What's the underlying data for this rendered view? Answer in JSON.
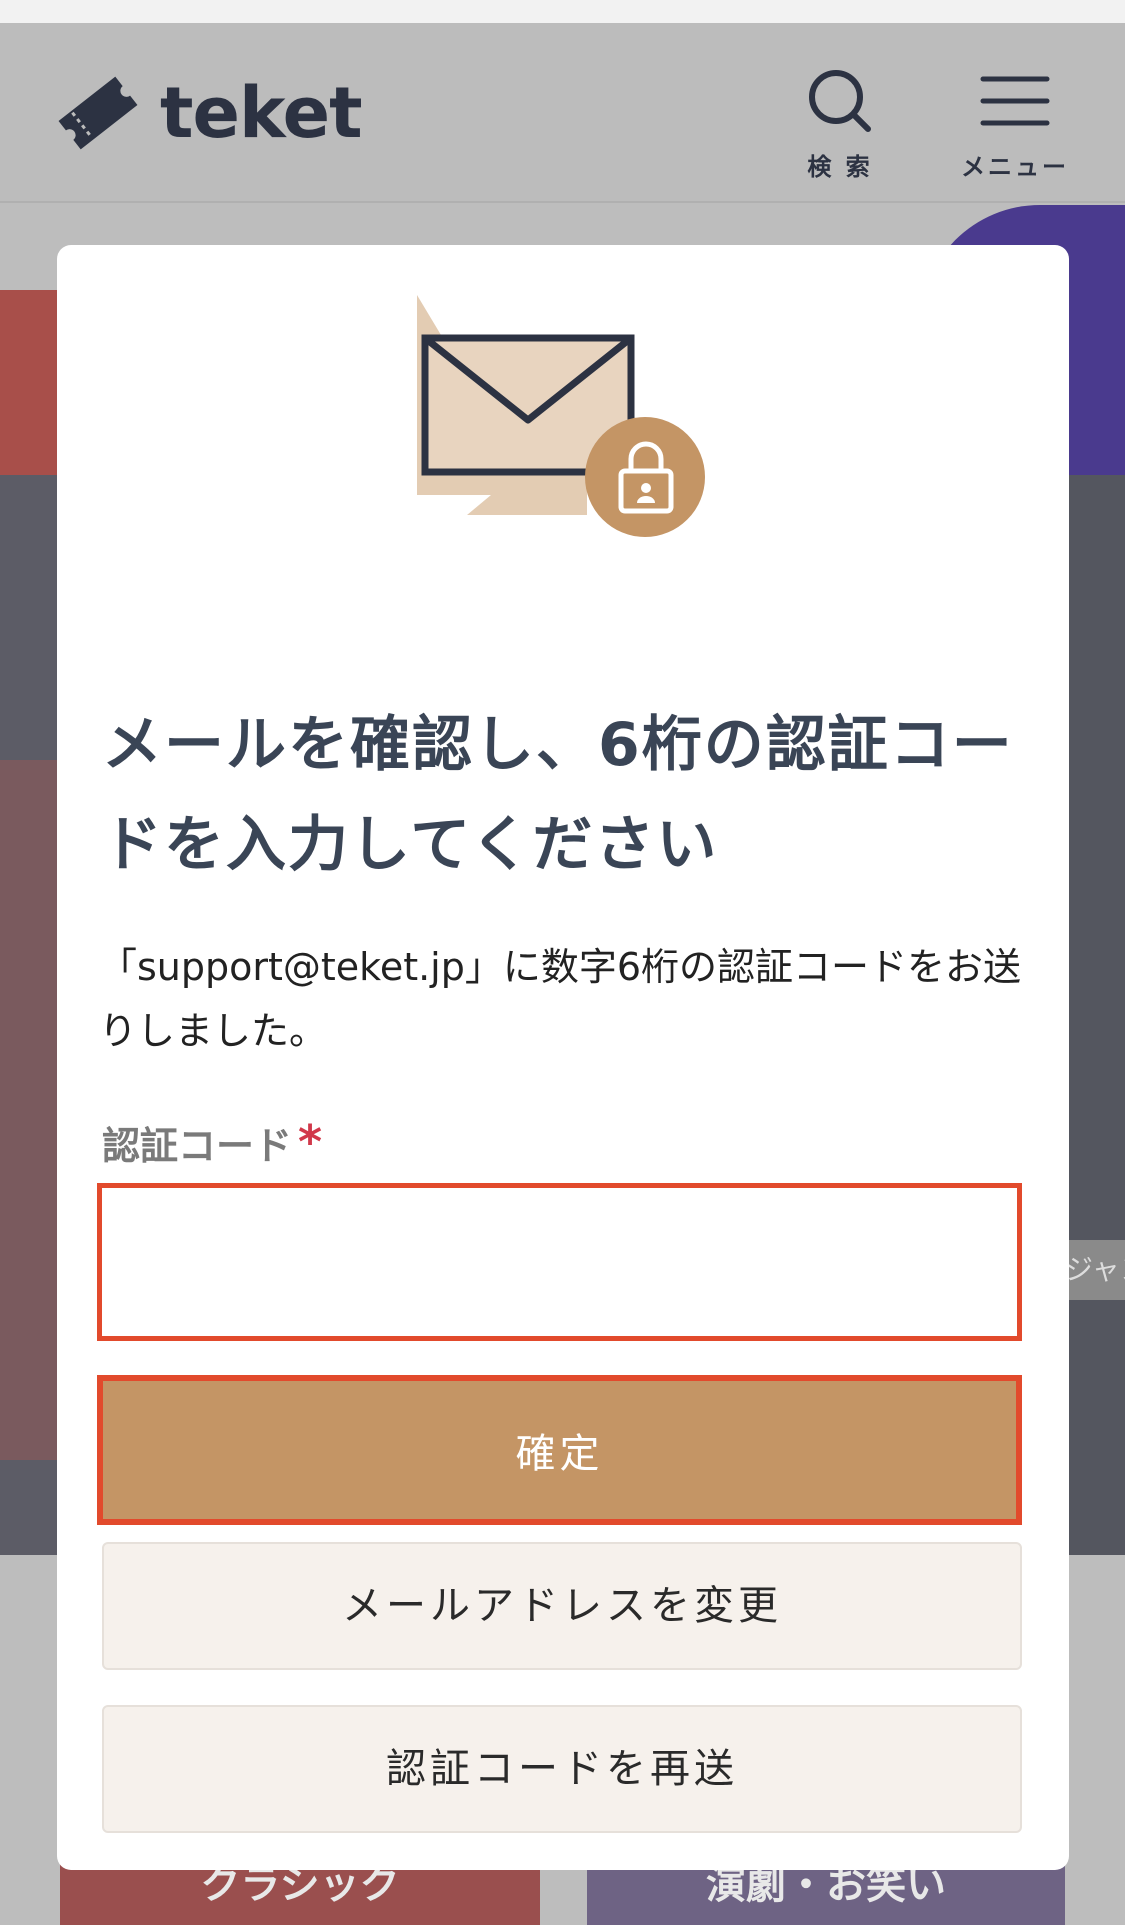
{
  "header": {
    "logo_text": "teket",
    "search_label": "検 索",
    "menu_label": "メニュー"
  },
  "background": {
    "right_tab_text": "ジャン",
    "categories": [
      "クラシック",
      "演劇・お笑い"
    ]
  },
  "modal": {
    "title": "メールを確認し、6桁の認証コードを入力してください",
    "description": "「support@teket.jp」に数字6桁の認証コードをお送りしました。",
    "field_label": "認証コード",
    "required_mark": "*",
    "code_input_value": "",
    "confirm_label": "確定",
    "change_email_label": "メールアドレスを変更",
    "resend_label": "認証コードを再送"
  },
  "colors": {
    "accent": "#c49565",
    "highlight_border": "#e24a2c",
    "title_text": "#3a4556",
    "required": "#d1384a",
    "secondary_button_bg": "#f6f1ec"
  }
}
